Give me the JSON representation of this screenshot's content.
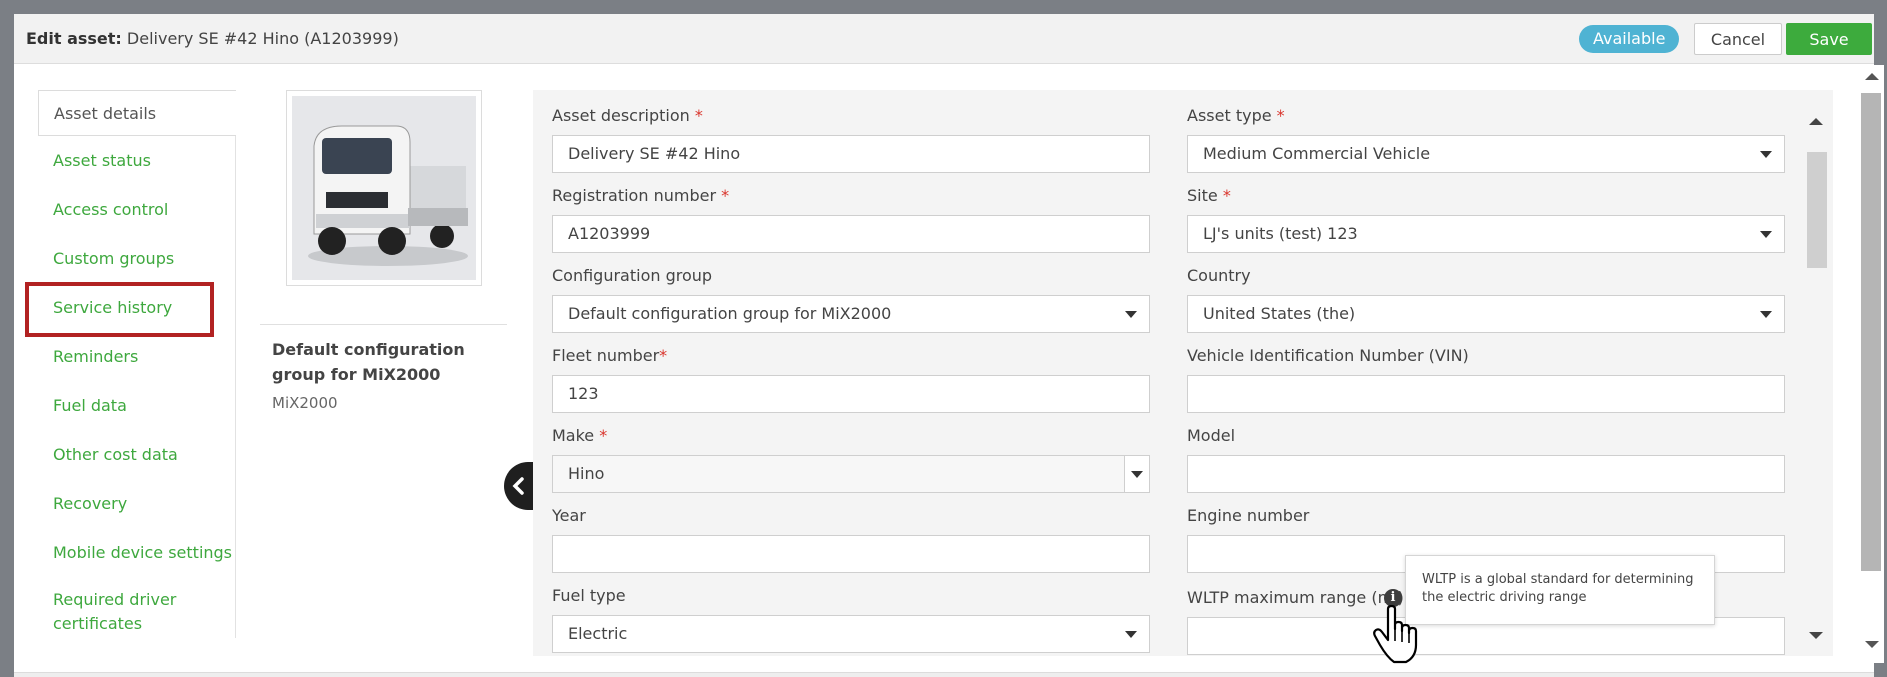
{
  "header": {
    "title_label": "Edit asset:",
    "title_value": "Delivery SE #42 Hino (A1203999)",
    "status_badge": "Available",
    "cancel_label": "Cancel",
    "save_label": "Save"
  },
  "sidebar": {
    "items": [
      {
        "label": "Asset details",
        "active": true
      },
      {
        "label": "Asset status"
      },
      {
        "label": "Access control"
      },
      {
        "label": "Custom groups"
      },
      {
        "label": "Service history",
        "highlighted": true
      },
      {
        "label": "Reminders"
      },
      {
        "label": "Fuel data"
      },
      {
        "label": "Other cost data"
      },
      {
        "label": "Recovery"
      },
      {
        "label": "Mobile device settings"
      },
      {
        "label": "Required driver certificates"
      }
    ]
  },
  "asset_card": {
    "config_title": "Default configuration group for MiX2000",
    "config_sub": "MiX2000"
  },
  "form": {
    "asset_description": {
      "label": "Asset description",
      "required": "*",
      "value": "Delivery SE #42 Hino"
    },
    "asset_type": {
      "label": "Asset type",
      "required": "*",
      "value": "Medium Commercial Vehicle"
    },
    "registration_number": {
      "label": "Registration number",
      "required": "*",
      "value": "A1203999"
    },
    "site": {
      "label": "Site",
      "required": "*",
      "value": "LJ's units (test) 123"
    },
    "configuration_group": {
      "label": "Configuration group",
      "value": "Default configuration group for MiX2000"
    },
    "country": {
      "label": "Country",
      "value": "United States (the)"
    },
    "fleet_number": {
      "label": "Fleet number",
      "required": "*",
      "value": "123"
    },
    "vin": {
      "label": "Vehicle Identification Number (VIN)",
      "value": ""
    },
    "make": {
      "label": "Make",
      "required": "*",
      "value": "Hino"
    },
    "model": {
      "label": "Model",
      "value": ""
    },
    "year": {
      "label": "Year",
      "value": ""
    },
    "engine_number": {
      "label": "Engine number",
      "value": ""
    },
    "fuel_type": {
      "label": "Fuel type",
      "value": "Electric"
    },
    "wltp_range": {
      "label": "WLTP maximum range (mi)",
      "value": ""
    }
  },
  "tooltip": {
    "text": "WLTP is a global standard for determining the electric driving range"
  },
  "icons": {
    "info": "info-icon",
    "collapse": "chevron-left-icon",
    "cursor": "hand-pointer-icon",
    "info_glyph": "i"
  },
  "colors": {
    "accent_green": "#3dab3d",
    "badge_blue": "#4fb3d3",
    "required_red": "#d9342b",
    "highlight_red": "#b22222"
  }
}
